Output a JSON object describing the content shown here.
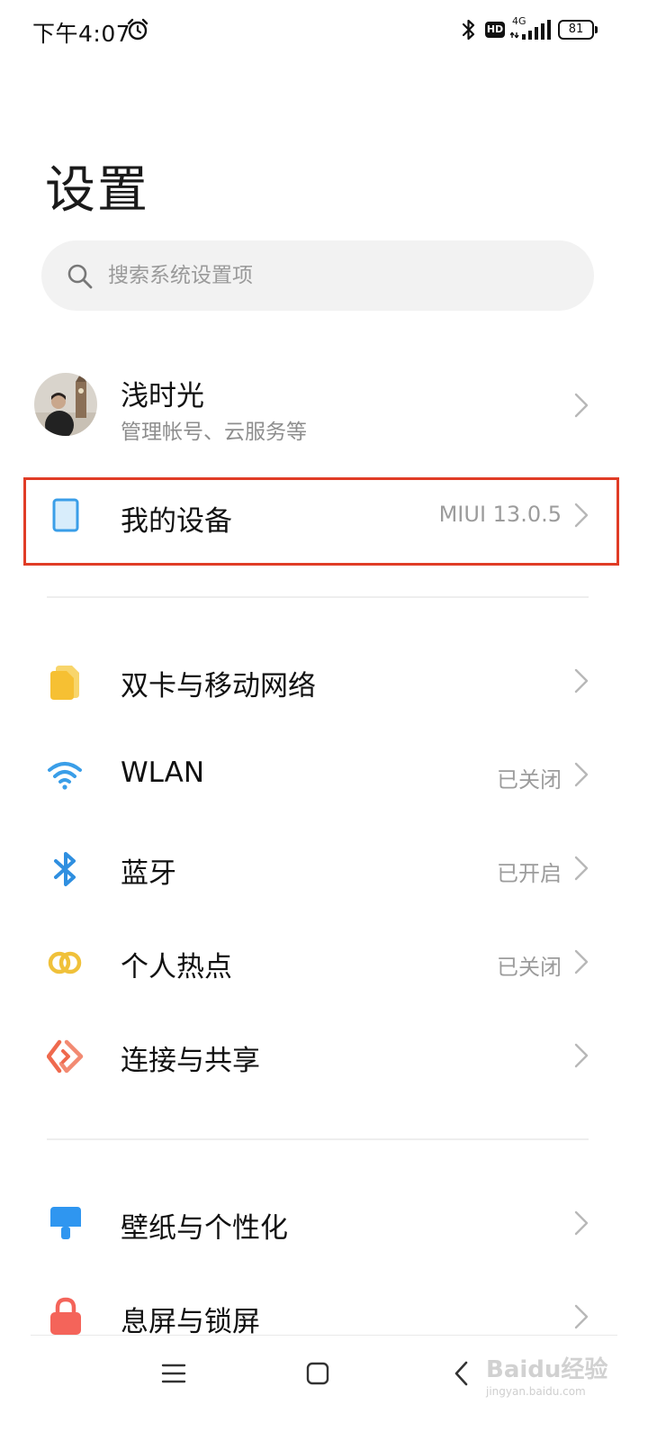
{
  "status_bar": {
    "time": "下午4:07",
    "network": "4G",
    "hd_label": "HD",
    "battery": "81"
  },
  "page": {
    "title": "设置"
  },
  "search": {
    "placeholder": "搜索系统设置项"
  },
  "account": {
    "name": "浅时光",
    "subtitle": "管理帐号、云服务等"
  },
  "device": {
    "label": "我的设备",
    "status": "MIUI 13.0.5"
  },
  "network_items": [
    {
      "label": "双卡与移动网络",
      "status": "",
      "icon": "sim-card-icon",
      "color": "#f7c23e"
    },
    {
      "label": "WLAN",
      "status": "已关闭",
      "icon": "wifi-icon",
      "color": "#3a9ee8"
    },
    {
      "label": "蓝牙",
      "status": "已开启",
      "icon": "bluetooth-icon",
      "color": "#2f8fe0"
    },
    {
      "label": "个人热点",
      "status": "已关闭",
      "icon": "hotspot-icon",
      "color": "#f0c13a"
    },
    {
      "label": "连接与共享",
      "status": "",
      "icon": "connection-share-icon",
      "color": "#ef6a4e"
    }
  ],
  "display_items": [
    {
      "label": "壁纸与个性化",
      "status": "",
      "icon": "wallpaper-icon",
      "color": "#2f96f0"
    },
    {
      "label": "息屏与锁屏",
      "status": "",
      "icon": "lock-icon",
      "color": "#f4645a"
    }
  ],
  "watermark": {
    "brand": "Baidu经验",
    "url": "jingyan.baidu.com"
  }
}
